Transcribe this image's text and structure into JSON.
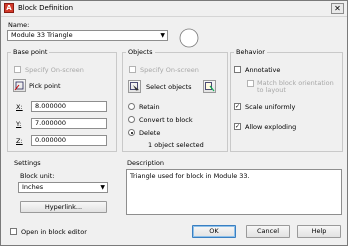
{
  "window": {
    "title": "Block Definition",
    "close_glyph": "✕"
  },
  "name": {
    "label": "Name:",
    "value": "Module 33 Triangle"
  },
  "base_point": {
    "title": "Base point",
    "specify_onscreen": "Specify On-screen",
    "pick_point": "Pick point",
    "x_label": "X:",
    "x_value": "8.000000",
    "y_label": "Y:",
    "y_value": "7.000000",
    "z_label": "Z:",
    "z_value": "0.000000"
  },
  "objects": {
    "title": "Objects",
    "specify_onscreen": "Specify On-screen",
    "select_objects": "Select objects",
    "retain": "Retain",
    "convert": "Convert to block",
    "delete": "Delete",
    "status": "1 object selected"
  },
  "behavior": {
    "title": "Behavior",
    "annotative": "Annotative",
    "match_orientation": "Match block orientation to layout",
    "scale_uniformly": "Scale uniformly",
    "allow_exploding": "Allow exploding"
  },
  "settings": {
    "title": "Settings",
    "block_unit_label": "Block unit:",
    "block_unit_value": "Inches",
    "hyperlink": "Hyperlink..."
  },
  "description": {
    "label": "Description",
    "text": "Triangle used for block in Module 33."
  },
  "footer": {
    "open_in_editor": "Open in block editor",
    "ok": "OK",
    "cancel": "Cancel",
    "help": "Help"
  },
  "icons": [
    "block-definition-icon",
    "pick-point-icon",
    "select-objects-icon",
    "quick-select-icon",
    "combo-arrow-icon",
    "preview-circle-icon"
  ]
}
